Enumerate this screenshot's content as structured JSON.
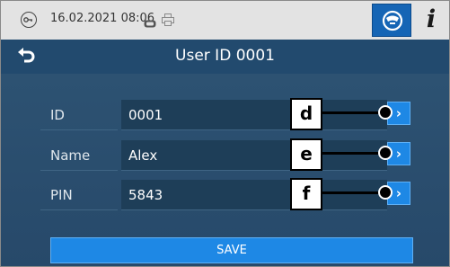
{
  "statusbar": {
    "datetime": "16.02.2021 08:06",
    "icons": [
      "key-icon",
      "sd-card-icon",
      "printer-icon",
      "sterilizer-icon",
      "info-icon"
    ],
    "info_label": "i"
  },
  "header": {
    "title": "User ID 0001",
    "back_icon": "back-arrow-icon"
  },
  "form": {
    "rows": [
      {
        "label": "ID",
        "value": "0001",
        "callout": "d",
        "arrow": "›"
      },
      {
        "label": "Name",
        "value": "Alex",
        "callout": "e",
        "arrow": "›"
      },
      {
        "label": "PIN",
        "value": "5843",
        "callout": "f",
        "arrow": "›"
      }
    ],
    "save_label": "SAVE"
  },
  "colors": {
    "accent": "#1e88e5",
    "background": "#2a4d6b",
    "statusbar": "#e3e3e3"
  }
}
